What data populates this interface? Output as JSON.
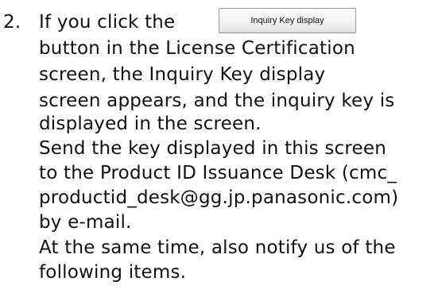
{
  "step": {
    "number": "2.",
    "line1_before_button": "If you click the",
    "button_label": "Inquiry Key display",
    "lines": [
      "button in the License Certification",
      "screen, the Inquiry Key display",
      "screen appears, and the inquiry key is",
      "displayed in the screen.",
      "Send the key displayed in this screen",
      "to the Product ID Issuance Desk (cmc_",
      "productid_desk@gg.jp.panasonic.com)",
      "by e-mail.",
      "At the same time, also notify us of the",
      "following items."
    ]
  }
}
